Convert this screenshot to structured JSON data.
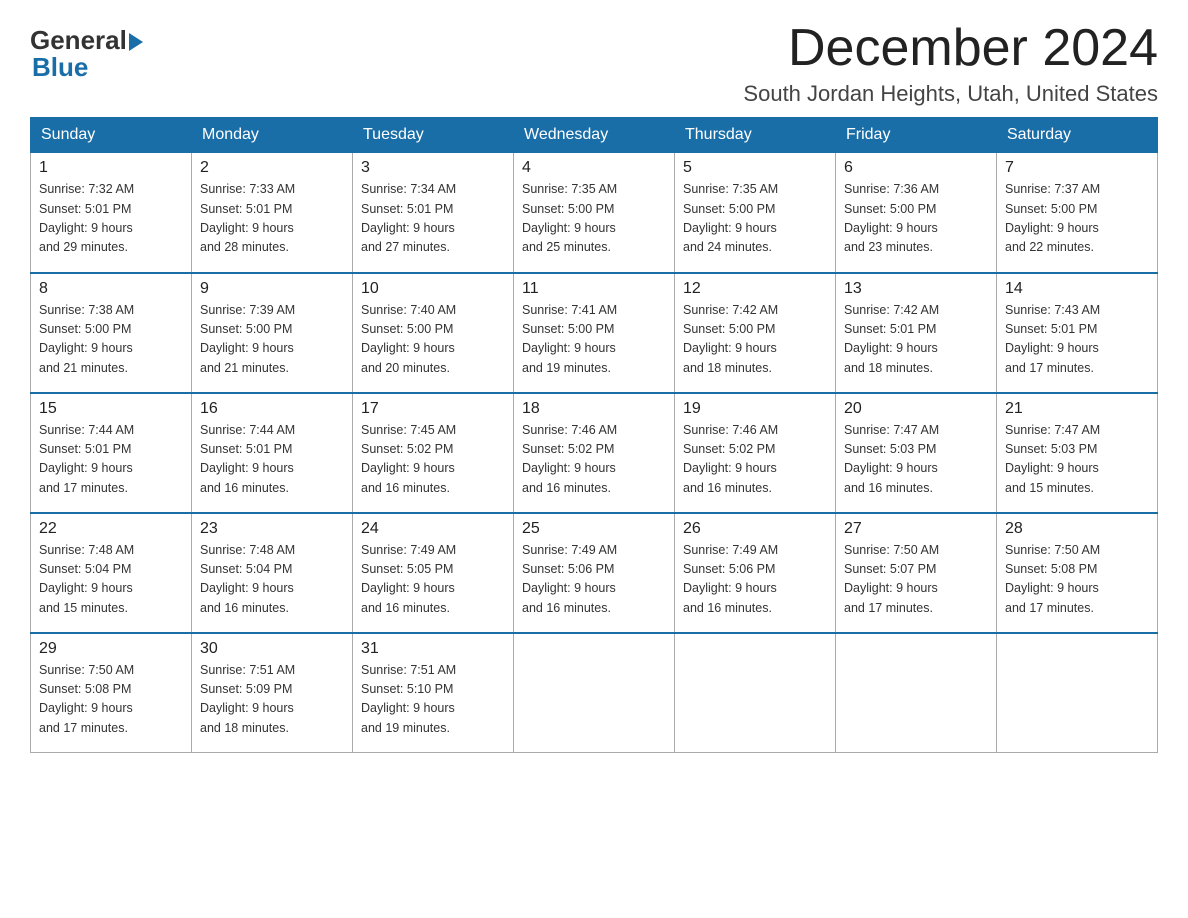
{
  "logo": {
    "general": "General",
    "blue": "Blue"
  },
  "header": {
    "month": "December 2024",
    "location": "South Jordan Heights, Utah, United States"
  },
  "weekdays": [
    "Sunday",
    "Monday",
    "Tuesday",
    "Wednesday",
    "Thursday",
    "Friday",
    "Saturday"
  ],
  "weeks": [
    [
      {
        "day": "1",
        "sunrise": "7:32 AM",
        "sunset": "5:01 PM",
        "daylight": "9 hours and 29 minutes."
      },
      {
        "day": "2",
        "sunrise": "7:33 AM",
        "sunset": "5:01 PM",
        "daylight": "9 hours and 28 minutes."
      },
      {
        "day": "3",
        "sunrise": "7:34 AM",
        "sunset": "5:01 PM",
        "daylight": "9 hours and 27 minutes."
      },
      {
        "day": "4",
        "sunrise": "7:35 AM",
        "sunset": "5:00 PM",
        "daylight": "9 hours and 25 minutes."
      },
      {
        "day": "5",
        "sunrise": "7:35 AM",
        "sunset": "5:00 PM",
        "daylight": "9 hours and 24 minutes."
      },
      {
        "day": "6",
        "sunrise": "7:36 AM",
        "sunset": "5:00 PM",
        "daylight": "9 hours and 23 minutes."
      },
      {
        "day": "7",
        "sunrise": "7:37 AM",
        "sunset": "5:00 PM",
        "daylight": "9 hours and 22 minutes."
      }
    ],
    [
      {
        "day": "8",
        "sunrise": "7:38 AM",
        "sunset": "5:00 PM",
        "daylight": "9 hours and 21 minutes."
      },
      {
        "day": "9",
        "sunrise": "7:39 AM",
        "sunset": "5:00 PM",
        "daylight": "9 hours and 21 minutes."
      },
      {
        "day": "10",
        "sunrise": "7:40 AM",
        "sunset": "5:00 PM",
        "daylight": "9 hours and 20 minutes."
      },
      {
        "day": "11",
        "sunrise": "7:41 AM",
        "sunset": "5:00 PM",
        "daylight": "9 hours and 19 minutes."
      },
      {
        "day": "12",
        "sunrise": "7:42 AM",
        "sunset": "5:00 PM",
        "daylight": "9 hours and 18 minutes."
      },
      {
        "day": "13",
        "sunrise": "7:42 AM",
        "sunset": "5:01 PM",
        "daylight": "9 hours and 18 minutes."
      },
      {
        "day": "14",
        "sunrise": "7:43 AM",
        "sunset": "5:01 PM",
        "daylight": "9 hours and 17 minutes."
      }
    ],
    [
      {
        "day": "15",
        "sunrise": "7:44 AM",
        "sunset": "5:01 PM",
        "daylight": "9 hours and 17 minutes."
      },
      {
        "day": "16",
        "sunrise": "7:44 AM",
        "sunset": "5:01 PM",
        "daylight": "9 hours and 16 minutes."
      },
      {
        "day": "17",
        "sunrise": "7:45 AM",
        "sunset": "5:02 PM",
        "daylight": "9 hours and 16 minutes."
      },
      {
        "day": "18",
        "sunrise": "7:46 AM",
        "sunset": "5:02 PM",
        "daylight": "9 hours and 16 minutes."
      },
      {
        "day": "19",
        "sunrise": "7:46 AM",
        "sunset": "5:02 PM",
        "daylight": "9 hours and 16 minutes."
      },
      {
        "day": "20",
        "sunrise": "7:47 AM",
        "sunset": "5:03 PM",
        "daylight": "9 hours and 16 minutes."
      },
      {
        "day": "21",
        "sunrise": "7:47 AM",
        "sunset": "5:03 PM",
        "daylight": "9 hours and 15 minutes."
      }
    ],
    [
      {
        "day": "22",
        "sunrise": "7:48 AM",
        "sunset": "5:04 PM",
        "daylight": "9 hours and 15 minutes."
      },
      {
        "day": "23",
        "sunrise": "7:48 AM",
        "sunset": "5:04 PM",
        "daylight": "9 hours and 16 minutes."
      },
      {
        "day": "24",
        "sunrise": "7:49 AM",
        "sunset": "5:05 PM",
        "daylight": "9 hours and 16 minutes."
      },
      {
        "day": "25",
        "sunrise": "7:49 AM",
        "sunset": "5:06 PM",
        "daylight": "9 hours and 16 minutes."
      },
      {
        "day": "26",
        "sunrise": "7:49 AM",
        "sunset": "5:06 PM",
        "daylight": "9 hours and 16 minutes."
      },
      {
        "day": "27",
        "sunrise": "7:50 AM",
        "sunset": "5:07 PM",
        "daylight": "9 hours and 17 minutes."
      },
      {
        "day": "28",
        "sunrise": "7:50 AM",
        "sunset": "5:08 PM",
        "daylight": "9 hours and 17 minutes."
      }
    ],
    [
      {
        "day": "29",
        "sunrise": "7:50 AM",
        "sunset": "5:08 PM",
        "daylight": "9 hours and 17 minutes."
      },
      {
        "day": "30",
        "sunrise": "7:51 AM",
        "sunset": "5:09 PM",
        "daylight": "9 hours and 18 minutes."
      },
      {
        "day": "31",
        "sunrise": "7:51 AM",
        "sunset": "5:10 PM",
        "daylight": "9 hours and 19 minutes."
      },
      null,
      null,
      null,
      null
    ]
  ],
  "labels": {
    "sunrise": "Sunrise: ",
    "sunset": "Sunset: ",
    "daylight": "Daylight: "
  }
}
